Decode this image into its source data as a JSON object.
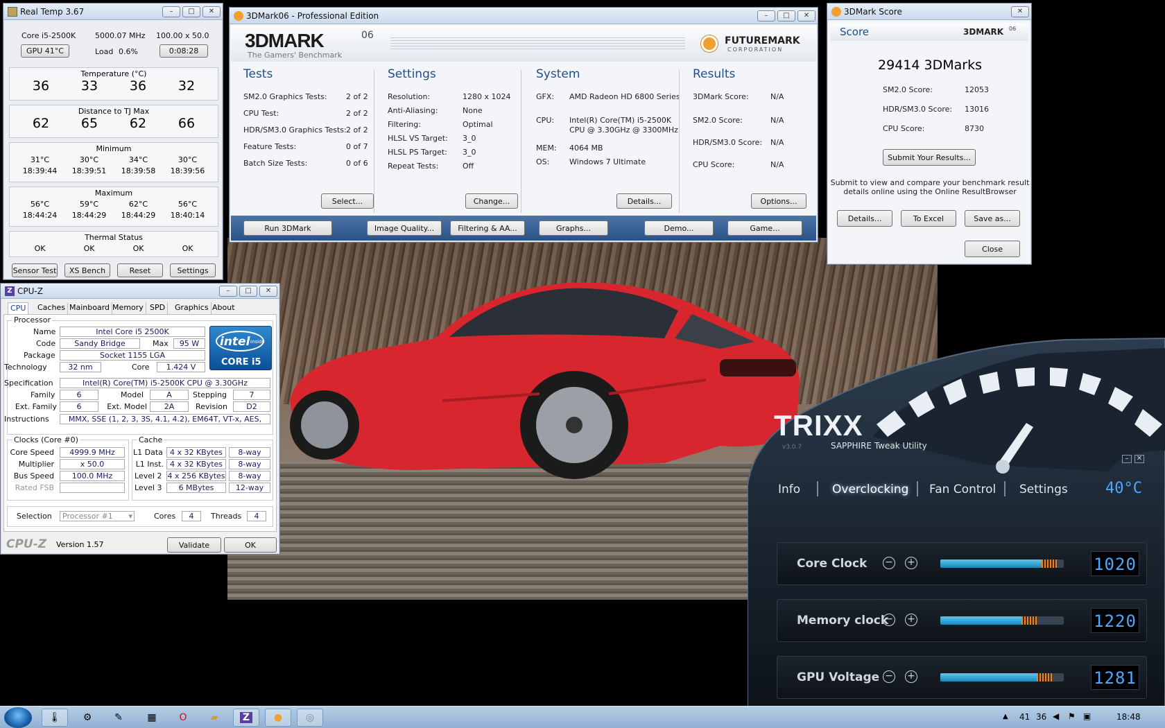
{
  "realtemp": {
    "title": "Real Temp 3.67",
    "cpu": "Core i5-2500K",
    "freq": "5000.07 MHz",
    "mult": "100.00 x 50.0",
    "gpu_btn": "GPU 41°C",
    "load_label": "Load",
    "load": "0.6%",
    "time": "0:08:28",
    "temp_title": "Temperature (°C)",
    "temps": [
      "36",
      "33",
      "36",
      "32"
    ],
    "dist_title": "Distance to TJ Max",
    "dist": [
      "62",
      "65",
      "62",
      "66"
    ],
    "min_title": "Minimum",
    "min_t": [
      "31°C",
      "30°C",
      "34°C",
      "30°C"
    ],
    "min_time": [
      "18:39:44",
      "18:39:51",
      "18:39:58",
      "18:39:56"
    ],
    "max_title": "Maximum",
    "max_t": [
      "56°C",
      "59°C",
      "62°C",
      "56°C"
    ],
    "max_time": [
      "18:44:24",
      "18:44:29",
      "18:44:29",
      "18:40:14"
    ],
    "thermal_title": "Thermal Status",
    "thermal": [
      "OK",
      "OK",
      "OK",
      "OK"
    ],
    "buttons": [
      "Sensor Test",
      "XS Bench",
      "Reset",
      "Settings"
    ]
  },
  "mark": {
    "title": "3DMark06 - Professional Edition",
    "logo": "3DMARK",
    "logo_sup": "06",
    "tagline": "The Gamers' Benchmark",
    "fm": "FUTUREMARK",
    "fm_sub": "CORPORATION",
    "tests_title": "Tests",
    "tests": [
      [
        "SM2.0 Graphics Tests:",
        "2 of 2"
      ],
      [
        "CPU Test:",
        "2 of 2"
      ],
      [
        "HDR/SM3.0 Graphics Tests:",
        "2 of 2"
      ],
      [
        "Feature Tests:",
        "0 of 7"
      ],
      [
        "Batch Size Tests:",
        "0 of 6"
      ]
    ],
    "settings_title": "Settings",
    "settings": [
      [
        "Resolution:",
        "1280 x 1024"
      ],
      [
        "Anti-Aliasing:",
        "None"
      ],
      [
        "Filtering:",
        "Optimal"
      ],
      [
        "HLSL VS Target:",
        "3_0"
      ],
      [
        "HLSL PS Target:",
        "3_0"
      ],
      [
        "Repeat Tests:",
        "Off"
      ]
    ],
    "system_title": "System",
    "sys_gfx_l": "GFX:",
    "sys_gfx": "AMD Radeon HD 6800 Series",
    "sys_cpu_l": "CPU:",
    "sys_cpu1": "Intel(R) Core(TM) i5-2500K",
    "sys_cpu2": "CPU @ 3.30GHz @ 3300MHz",
    "sys_mem_l": "MEM:",
    "sys_mem": "4064 MB",
    "sys_os_l": "OS:",
    "sys_os": "Windows 7 Ultimate",
    "results_title": "Results",
    "results": [
      [
        "3DMark Score:",
        "N/A"
      ],
      [
        "SM2.0 Score:",
        "N/A"
      ],
      [
        "HDR/SM3.0 Score:",
        "N/A"
      ],
      [
        "CPU Score:",
        "N/A"
      ]
    ],
    "btn_select": "Select...",
    "btn_change": "Change...",
    "btn_details": "Details...",
    "btn_options": "Options...",
    "bottom": [
      "Run 3DMark",
      "Image Quality...",
      "Filtering & AA...",
      "Graphs...",
      "Demo...",
      "Game..."
    ]
  },
  "score": {
    "title": "3DMark Score",
    "header": "Score",
    "logo": "3DMARK",
    "logo_sup": "06",
    "total": "29414 3DMarks",
    "sm2_l": "SM2.0 Score:",
    "sm2": "12053",
    "hdr_l": "HDR/SM3.0 Score:",
    "hdr": "13016",
    "cpu_l": "CPU Score:",
    "cpu": "8730",
    "submit": "Submit Your Results...",
    "desc1": "Submit to view and compare your benchmark result",
    "desc2": "details online using the Online ResultBrowser",
    "btns": [
      "Details...",
      "To Excel",
      "Save as..."
    ],
    "close": "Close"
  },
  "cpuz": {
    "title": "CPU-Z",
    "tabs": [
      "CPU",
      "Caches",
      "Mainboard",
      "Memory",
      "SPD",
      "Graphics",
      "About"
    ],
    "processor": "Processor",
    "name_l": "Name",
    "name": "Intel Core i5 2500K",
    "code_l": "Code",
    "code": "Sandy Bridge",
    "max_l": "Max",
    "max": "95 W",
    "pkg_l": "Package",
    "pkg": "Socket 1155 LGA",
    "tech_l": "Technology",
    "tech": "32 nm",
    "core_l": "Core",
    "corev": "1.424 V",
    "spec_l": "Specification",
    "spec": "Intel(R) Core(TM) i5-2500K CPU @ 3.30GHz",
    "fam_l": "Family",
    "fam": "6",
    "model_l": "Model",
    "model": "A",
    "step_l": "Stepping",
    "step": "7",
    "ext_l": "Ext. Family",
    "ext": "6",
    "extm_l": "Ext. Model",
    "extm": "2A",
    "rev_l": "Revision",
    "rev": "D2",
    "ins_l": "Instructions",
    "ins": "MMX, SSE (1, 2, 3, 3S, 4.1, 4.2), EM64T, VT-x, AES,",
    "clocks": "Clocks (Core #0)",
    "cspeed_l": "Core Speed",
    "cspeed": "4999.9 MHz",
    "mult_l": "Multiplier",
    "mult": "x 50.0",
    "bus_l": "Bus Speed",
    "bus": "100.0 MHz",
    "fsb_l": "Rated FSB",
    "fsb": "",
    "cache": "Cache",
    "l1d_l": "L1 Data",
    "l1d": "4 x 32 KBytes",
    "l1d_w": "8-way",
    "l1i_l": "L1 Inst.",
    "l1i": "4 x 32 KBytes",
    "l1i_w": "8-way",
    "l2_l": "Level 2",
    "l2": "4 x 256 KBytes",
    "l2_w": "8-way",
    "l3_l": "Level 3",
    "l3": "6 MBytes",
    "l3_w": "12-way",
    "sel_l": "Selection",
    "sel": "Processor #1",
    "cores_l": "Cores",
    "cores": "4",
    "threads_l": "Threads",
    "threads": "4",
    "brand": "CPU-Z",
    "version": "Version 1.57",
    "validate": "Validate",
    "ok": "OK",
    "intel": "intel",
    "inside": "inside",
    "corei5": "CORE i5"
  },
  "trixx": {
    "brand": "TRIXX",
    "version": "v3.0.7",
    "sub": "SAPPHIRE Tweak Utility",
    "tabs": [
      "Info",
      "Overclocking",
      "Fan Control",
      "Settings"
    ],
    "temp": "40°C",
    "rows": [
      {
        "label": "Core Clock",
        "value": "1020",
        "level": 0.82
      },
      {
        "label": "Memory clock",
        "value": "1220",
        "level": 0.66
      },
      {
        "label": "GPU Voltage",
        "value": "1281",
        "level": 0.78
      }
    ]
  },
  "taskbar": {
    "tray": [
      "41",
      "36"
    ],
    "clock": "18:48"
  },
  "colors": {
    "accent": "#1e4f8a",
    "trixx_blue": "#4fa8ff",
    "car_red": "#d8262e"
  }
}
